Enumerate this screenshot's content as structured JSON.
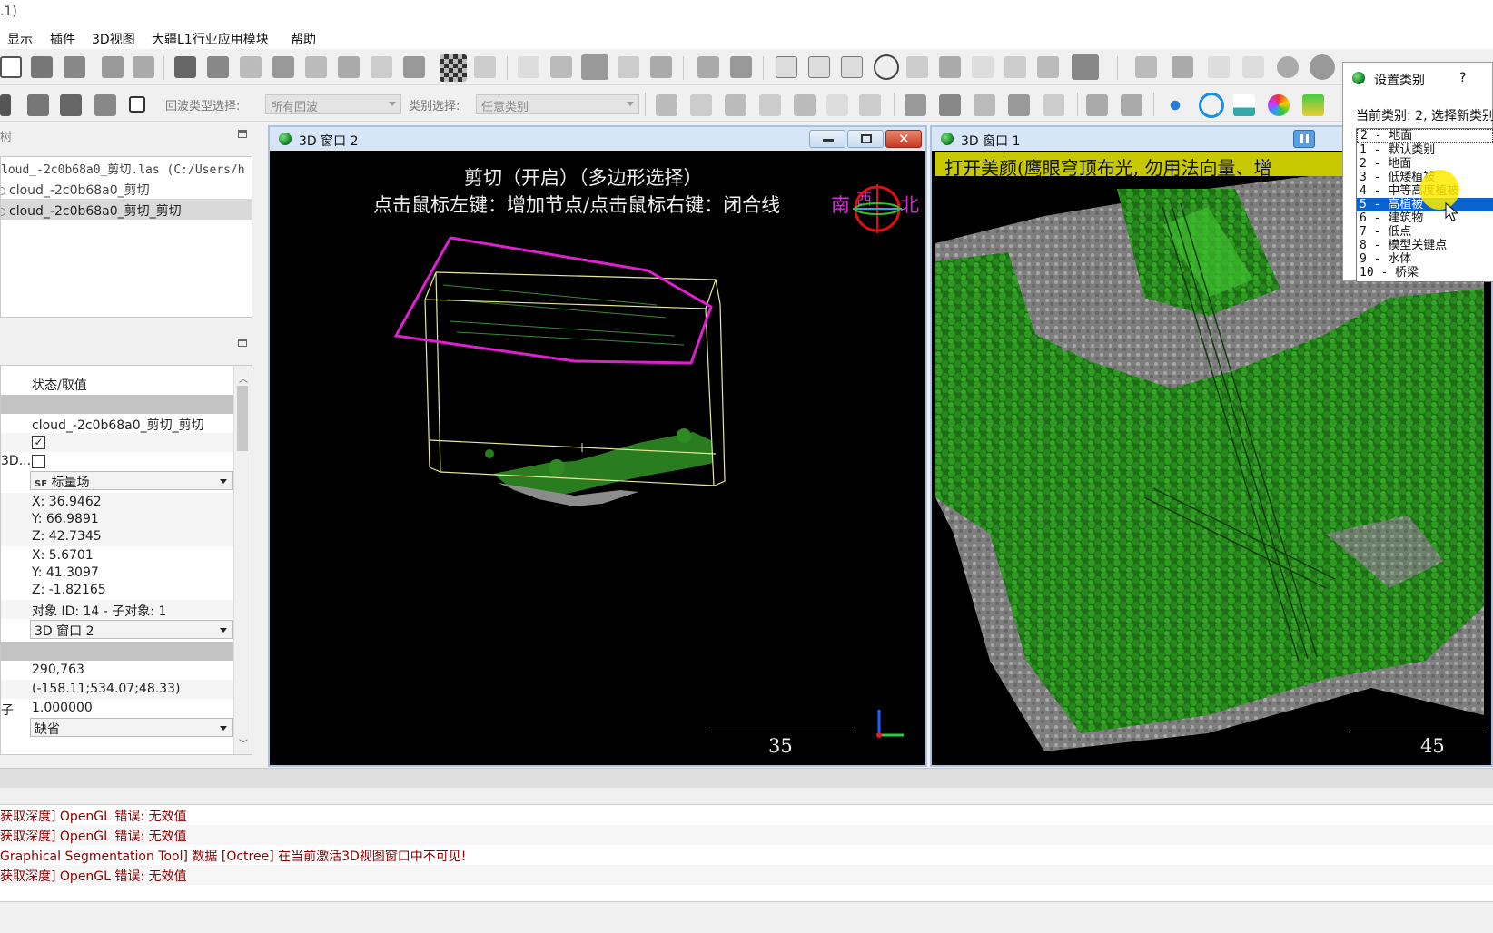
{
  "window": {
    "title": ".1)"
  },
  "menu": [
    "显示",
    "插件",
    "3D视图",
    "大疆L1行业应用模块",
    "帮助"
  ],
  "toolbar2": {
    "echo_label": "回波类型选择:",
    "echo_value": "所有回波",
    "class_label": "类别选择:",
    "class_value": "任意类别"
  },
  "tree": {
    "header": "树",
    "items": [
      {
        "label": "loud_-2c0b68a0_剪切.las (C:/Users/h"
      },
      {
        "label": "cloud_-2c0b68a0_剪切"
      },
      {
        "label": "cloud_-2c0b68a0_剪切_剪切"
      }
    ]
  },
  "properties": {
    "column_header": "状态/取值",
    "name_value": "cloud_-2c0b68a0_剪切_剪切",
    "row_3d_label": "3D...",
    "checkbox_visible": true,
    "checkbox_3d": false,
    "scalar_field": "标量场",
    "center": {
      "x": "X: 36.9462",
      "y": "Y: 66.9891",
      "z": "Z: 42.7345"
    },
    "extent": {
      "x": "X: 5.6701",
      "y": "Y: 41.3097",
      "z": "Z: -1.82165"
    },
    "object_id": "对象 ID: 14 - 子对象: 1",
    "display_window": "3D 窗口 2",
    "point_count": "290,763",
    "shift": "(-158.11;534.07;48.33)",
    "scale_key": "子",
    "scale_value": "1.000000",
    "default_combo": "缺省"
  },
  "win2": {
    "title": "3D 窗口 2",
    "line1": "剪切（开启）（多边形选择）",
    "line2": "点击鼠标左键：增加节点/点击鼠标右键：闭合线",
    "compass_south": "南",
    "compass_west": "西",
    "compass_north": "北",
    "scale": "35"
  },
  "win1": {
    "title": "3D 窗口 1",
    "banner": "打开美颜(鹰眼穹顶布光, 勿用法向量、增",
    "scale": "45"
  },
  "dialog": {
    "title": "设置类别",
    "help": "?",
    "current": "当前类别: 2, 选择新类别",
    "selected_box": "2 - 地面",
    "options": [
      "1 - 默认类别",
      "2 - 地面",
      "3 - 低矮植被",
      "4 - 中等高度植被",
      "5 - 高植被",
      "6 - 建筑物",
      "7 - 低点",
      "8 - 模型关键点",
      "9 - 水体",
      "10 - 桥梁"
    ],
    "highlighted_index": 4
  },
  "console": [
    "获取深度] OpenGL 错误: 无效值",
    "获取深度] OpenGL 错误: 无效值",
    "Graphical Segmentation Tool] 数据 [Octree] 在当前激活3D视图窗口中不可见!",
    "获取深度] OpenGL 错误: 无效值"
  ],
  "colors": {
    "polygon": "#e020d0",
    "bbox": "#e8e89a",
    "vegetation": "#2e8b22",
    "banner_bg": "#c8c800",
    "selection": "#0a64d0",
    "log_text": "#8b0000"
  }
}
